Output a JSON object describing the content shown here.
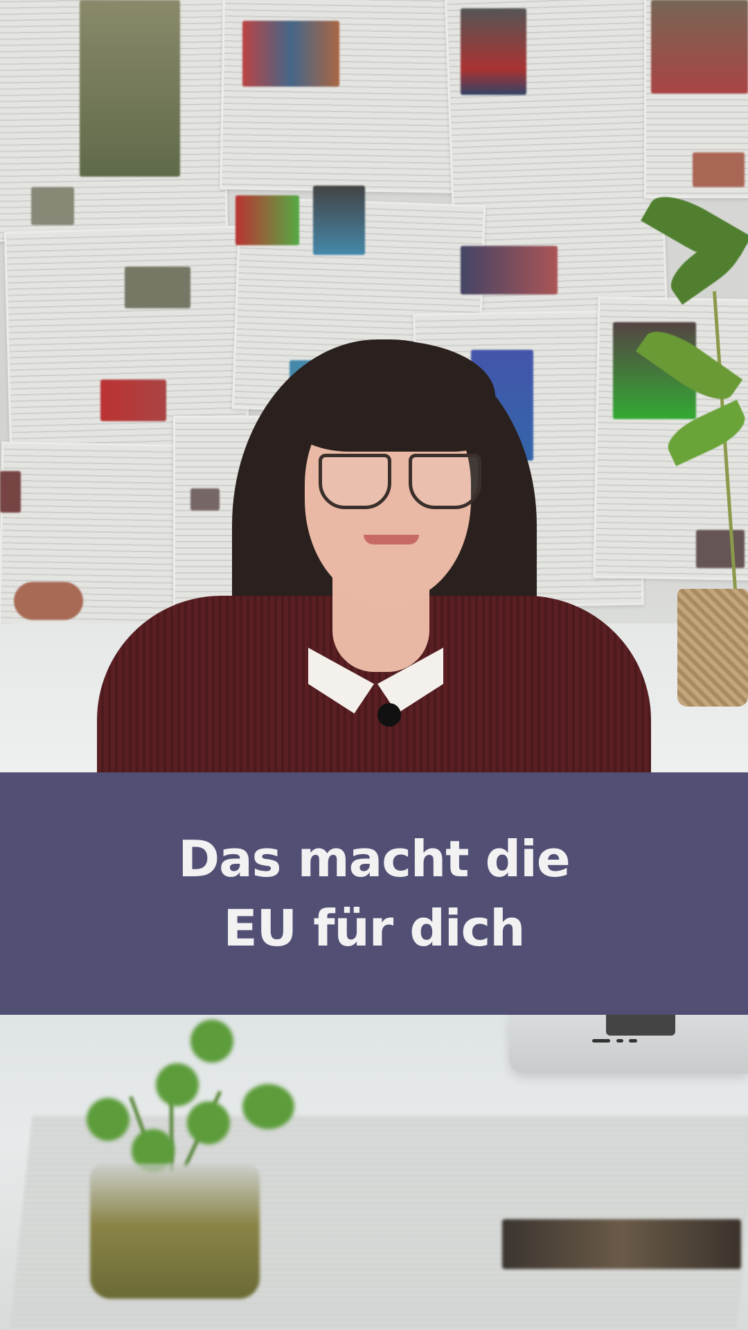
{
  "video": {
    "title_lines": [
      "Das macht die",
      "EU für dich"
    ]
  },
  "colors": {
    "banner_background": "#524f75",
    "title_text": "#f2f2f2"
  },
  "scene": {
    "background": "newspaper-wall",
    "subject": "person-speaking",
    "foreground": "desk-with-plant-and-laptop"
  }
}
